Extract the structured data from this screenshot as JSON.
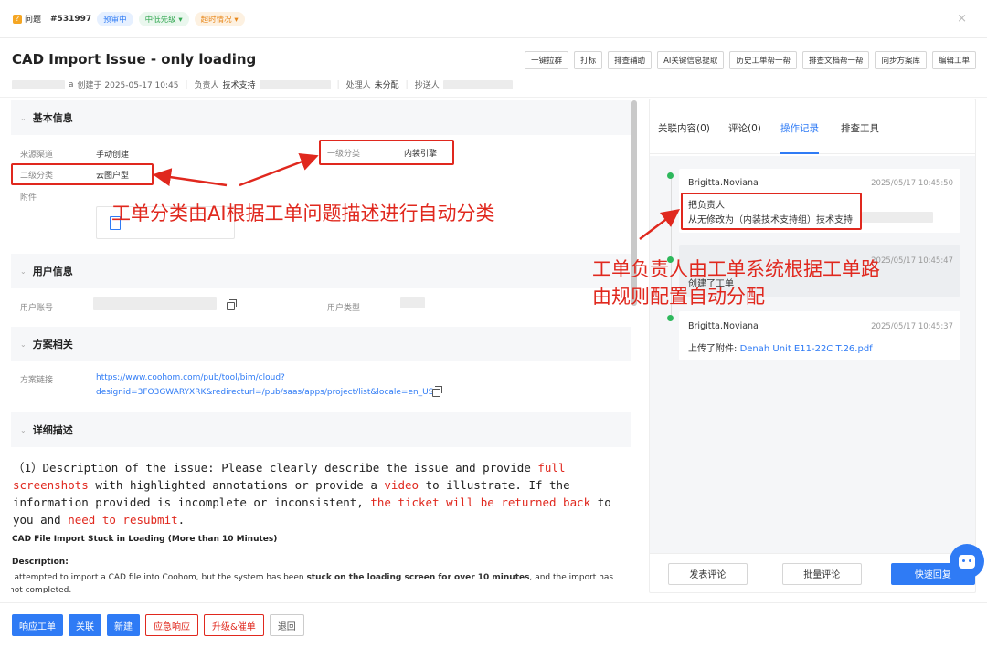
{
  "header": {
    "type_label": "问题",
    "ticket_id": "#531997",
    "status_badge": "预审中",
    "priority_badge": "中低先级 ▾",
    "timeout_badge": "超时情况 ▾",
    "close_symbol": "×"
  },
  "ticket": {
    "title": "CAD Import Issue - only loading",
    "creator_suffix": "a",
    "created_text": "创建于 2025-05-17 10:45",
    "owner_label": "负责人",
    "owner_value": "技术支持",
    "handler_label": "处理人",
    "handler_value": "未分配",
    "cc_label": "抄送人"
  },
  "toolbar": {
    "buttons": [
      "一键拉群",
      "打标",
      "排查辅助",
      "AI关键信息提取",
      "历史工单帮一帮",
      "排查文档帮一帮",
      "同步方案库",
      "编辑工单"
    ]
  },
  "sections": {
    "basic": {
      "title": "基本信息",
      "source_label": "来源渠道",
      "source_value": "手动创建",
      "category1_label": "一级分类",
      "category1_value": "内装引擎",
      "category2_label": "二级分类",
      "category2_value": "云图户型",
      "attachment_label": "附件"
    },
    "user": {
      "title": "用户信息",
      "account_label": "用户账号",
      "type_label": "用户类型"
    },
    "plan": {
      "title": "方案相关",
      "link_label": "方案链接",
      "link_line1": "https://www.coohom.com/pub/tool/bim/cloud?",
      "link_line2": "designid=3FO3GWARYXRK&redirecturl=/pub/saas/apps/project/list&locale=en_US"
    },
    "detail": {
      "title": "详细描述",
      "p1_a": "（1）Description of the issue: Please clearly describe the issue and provide ",
      "p1_b": "full screenshots",
      "p1_c": " with highlighted annotations or provide a ",
      "p1_d": "video",
      "p1_e": " to illustrate. If the information provided is incomplete or inconsistent, ",
      "p1_f": "the ticket will be returned back",
      "p1_g": " to you and ",
      "p1_h": "need to resubmit",
      "p1_i": ".",
      "heading": "CAD File Import Stuck in Loading (More than 10 Minutes)",
      "desc_label": "Description:",
      "desc_a": "I attempted to import a CAD file into Coohom, but the system has been ",
      "desc_b": "stuck on the loading screen for over 10 minutes",
      "desc_c": ", and the import has not completed."
    }
  },
  "right_panel": {
    "tabs": [
      "关联内容(0)",
      "评论(0)",
      "操作记录",
      "排查工具"
    ],
    "active_tab": "操作记录",
    "entries": [
      {
        "name": "Brigitta.Noviana",
        "time": "2025/05/17 10:45:50",
        "line1": "把负责人",
        "line2": "从无修改为（内装技术支持组）技术支持"
      },
      {
        "time": "2025/05/17 10:45:47",
        "line1": "创建了工单"
      },
      {
        "name": "Brigitta.Noviana",
        "time": "2025/05/17 10:45:37",
        "line1_label": "上传了附件: ",
        "line1_link": "Denah Unit E11-22C T.26.pdf"
      }
    ],
    "footer": {
      "comment": "发表评论",
      "batch": "批量评论",
      "quick_reply": "快速回复"
    }
  },
  "bottom_actions": [
    "响应工单",
    "关联",
    "新建",
    "应急响应",
    "升级&催单",
    "退回"
  ],
  "annotations": {
    "classify": "工单分类由AI根据工单问题描述进行自动分类",
    "assign_line1": "工单负责人由工单系统根据工单路",
    "assign_line2": "由规则配置自动分配"
  },
  "colors": {
    "primary": "#2f7bf5",
    "annotation_red": "#e0281e",
    "timeline_green": "#2eb85c"
  }
}
